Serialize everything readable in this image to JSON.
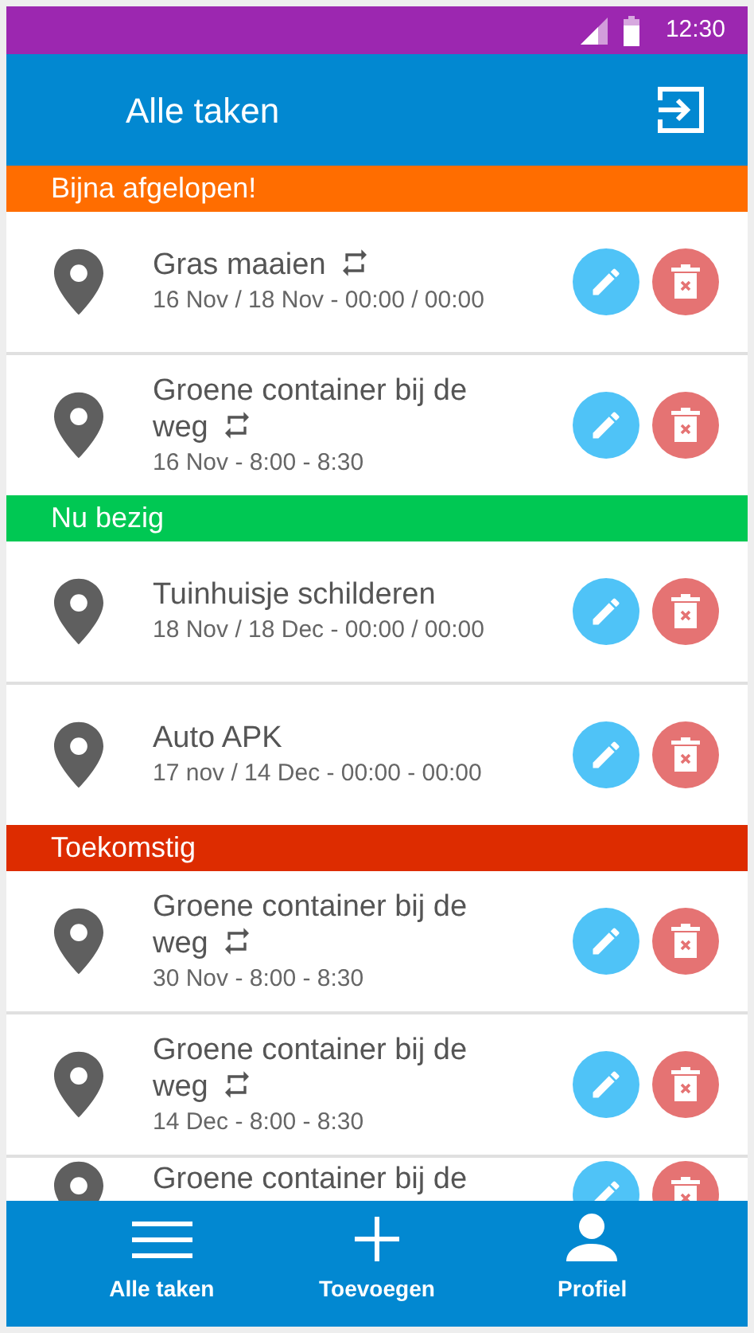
{
  "status_bar": {
    "time": "12:30"
  },
  "app_bar": {
    "title": "Alle taken"
  },
  "sections": [
    {
      "title": "Bijna afgelopen!",
      "color": "#ff6d00",
      "tasks": [
        {
          "title": "Gras maaien",
          "date": "16 Nov / 18 Nov - 00:00 / 00:00",
          "repeat": true
        },
        {
          "title": "Groene container bij de weg",
          "date": "16 Nov - 8:00 - 8:30",
          "repeat": true
        }
      ]
    },
    {
      "title": "Nu bezig",
      "color": "#00c853",
      "tasks": [
        {
          "title": "Tuinhuisje schilderen",
          "date": "18 Nov / 18 Dec - 00:00 / 00:00",
          "repeat": false
        },
        {
          "title": "Auto APK",
          "date": "17 nov / 14 Dec - 00:00 - 00:00",
          "repeat": false
        }
      ]
    },
    {
      "title": "Toekomstig",
      "color": "#dd2c00",
      "tasks": [
        {
          "title": "Groene container bij de weg",
          "date": "30 Nov - 8:00 - 8:30",
          "repeat": true
        },
        {
          "title": "Groene container bij de weg",
          "date": "14 Dec - 8:00 - 8:30",
          "repeat": true
        },
        {
          "title": "Groene container bij de",
          "repeat": false
        }
      ]
    }
  ],
  "bottom_nav": [
    {
      "kind": "list",
      "label": "Alle taken"
    },
    {
      "kind": "add",
      "label": "Toevoegen"
    },
    {
      "kind": "profile",
      "label": "Profiel"
    }
  ]
}
